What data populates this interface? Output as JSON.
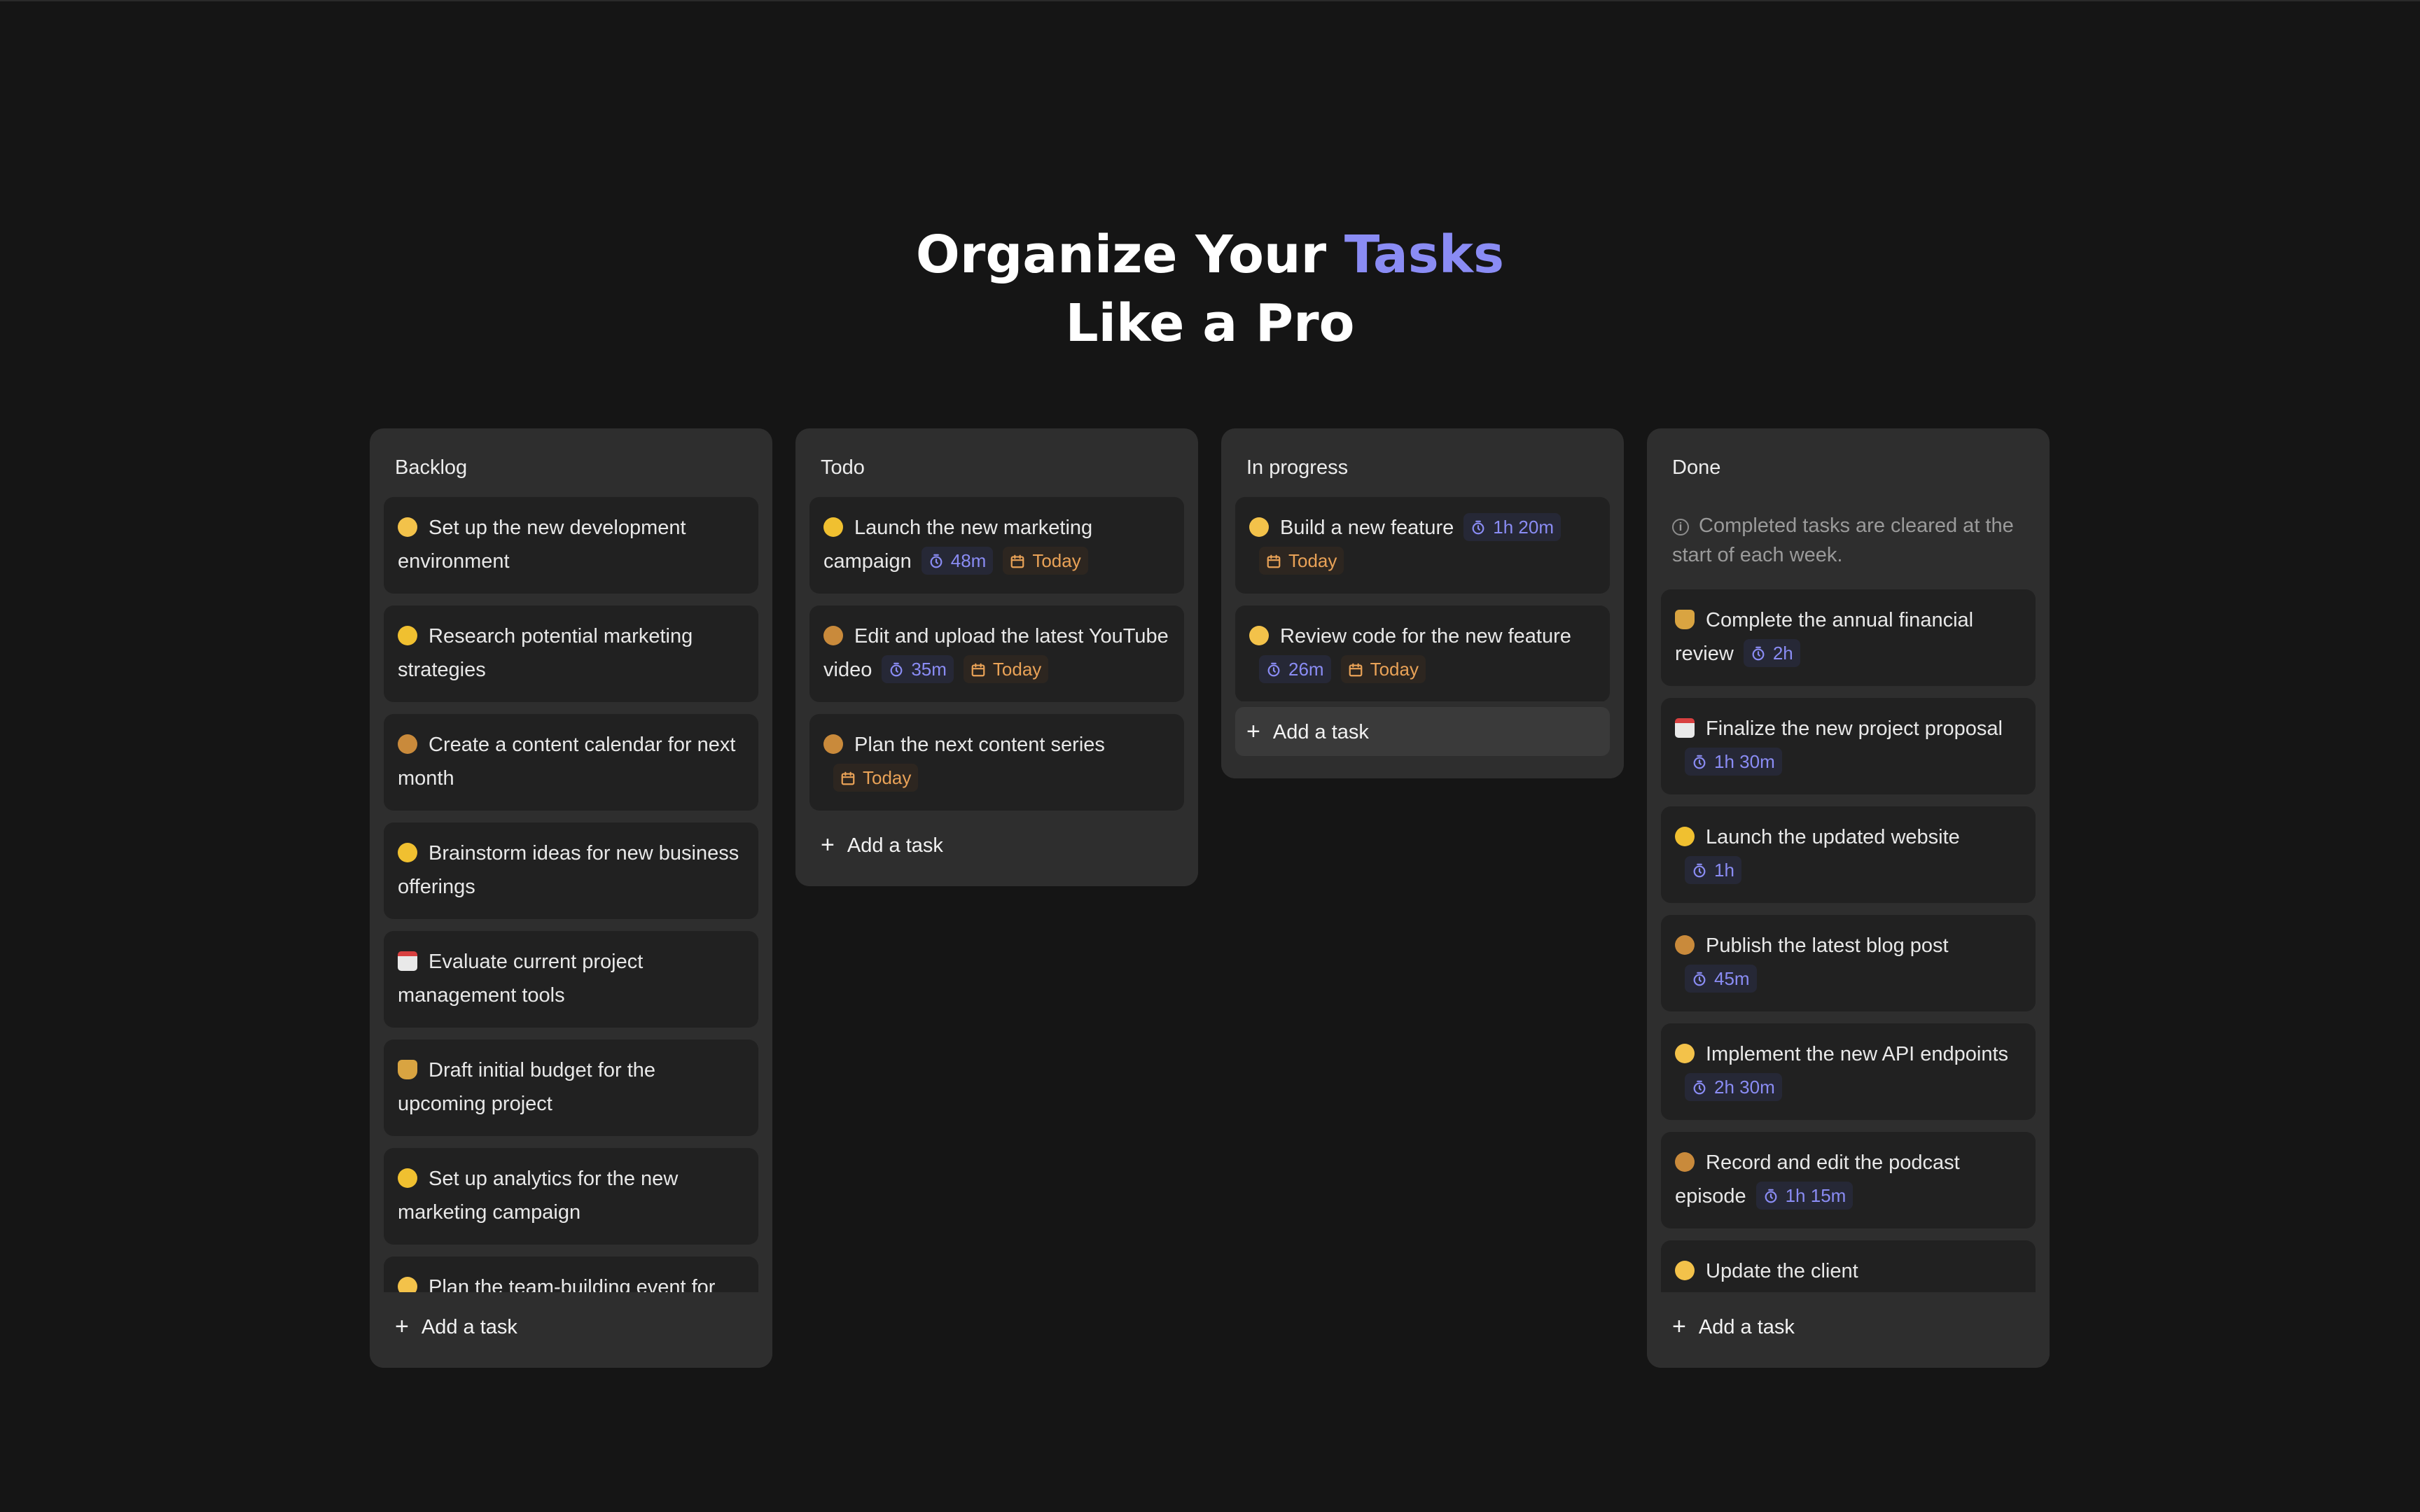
{
  "hero": {
    "line1_prefix": "Organize Your ",
    "line1_accent": "Tasks",
    "line2": "Like a Pro"
  },
  "colors": {
    "background": "#151515",
    "column": "#2e2e2e",
    "card": "#212121",
    "accent": "#8a8cf4",
    "date": "#e9a257"
  },
  "add_task_label": "Add a task",
  "columns": [
    {
      "title": "Backlog",
      "tasks": [
        {
          "emoji": "person-icon",
          "title": "Set up the new development environment"
        },
        {
          "emoji": "grin-icon",
          "title": "Research potential marketing strategies"
        },
        {
          "emoji": "palette-icon",
          "title": "Create a content calendar for next month"
        },
        {
          "emoji": "grin-icon",
          "title": "Brainstorm ideas for new business offerings"
        },
        {
          "emoji": "calendar-icon",
          "title": "Evaluate current project management tools"
        },
        {
          "emoji": "money-bag-icon",
          "title": "Draft initial budget for the upcoming project"
        },
        {
          "emoji": "grin-icon",
          "title": "Set up analytics for the new marketing campaign"
        },
        {
          "emoji": "person-icon",
          "title": "Plan the team-building event for"
        }
      ]
    },
    {
      "title": "Todo",
      "tasks": [
        {
          "emoji": "grin-icon",
          "title": "Launch the new marketing campaign",
          "time": "48m",
          "date": "Today"
        },
        {
          "emoji": "palette-icon",
          "title": "Edit and upload the latest YouTube video",
          "time": "35m",
          "date": "Today"
        },
        {
          "emoji": "palette-icon",
          "title": "Plan the next content series",
          "date": "Today"
        }
      ]
    },
    {
      "title": "In progress",
      "tasks": [
        {
          "emoji": "person-icon",
          "title": "Build a new feature",
          "time": "1h 20m",
          "date": "Today"
        },
        {
          "emoji": "person-icon",
          "title": "Review code for the new feature",
          "time": "26m",
          "date": "Today"
        }
      ]
    },
    {
      "title": "Done",
      "note": "Completed tasks are cleared at the start of each week.",
      "tasks": [
        {
          "emoji": "money-bag-icon",
          "title": "Complete the annual financial review",
          "time": "2h"
        },
        {
          "emoji": "calendar-icon",
          "title": "Finalize the new project proposal",
          "time": "1h 30m"
        },
        {
          "emoji": "grin-icon",
          "title": "Launch the updated website",
          "time": "1h"
        },
        {
          "emoji": "palette-icon",
          "title": "Publish the latest blog post",
          "time": "45m"
        },
        {
          "emoji": "person-icon",
          "title": "Implement the new API endpoints",
          "time": "2h 30m"
        },
        {
          "emoji": "palette-icon",
          "title": "Record and edit the podcast episode",
          "time": "1h 15m"
        },
        {
          "emoji": "person-icon",
          "title": "Update the client"
        }
      ]
    }
  ]
}
